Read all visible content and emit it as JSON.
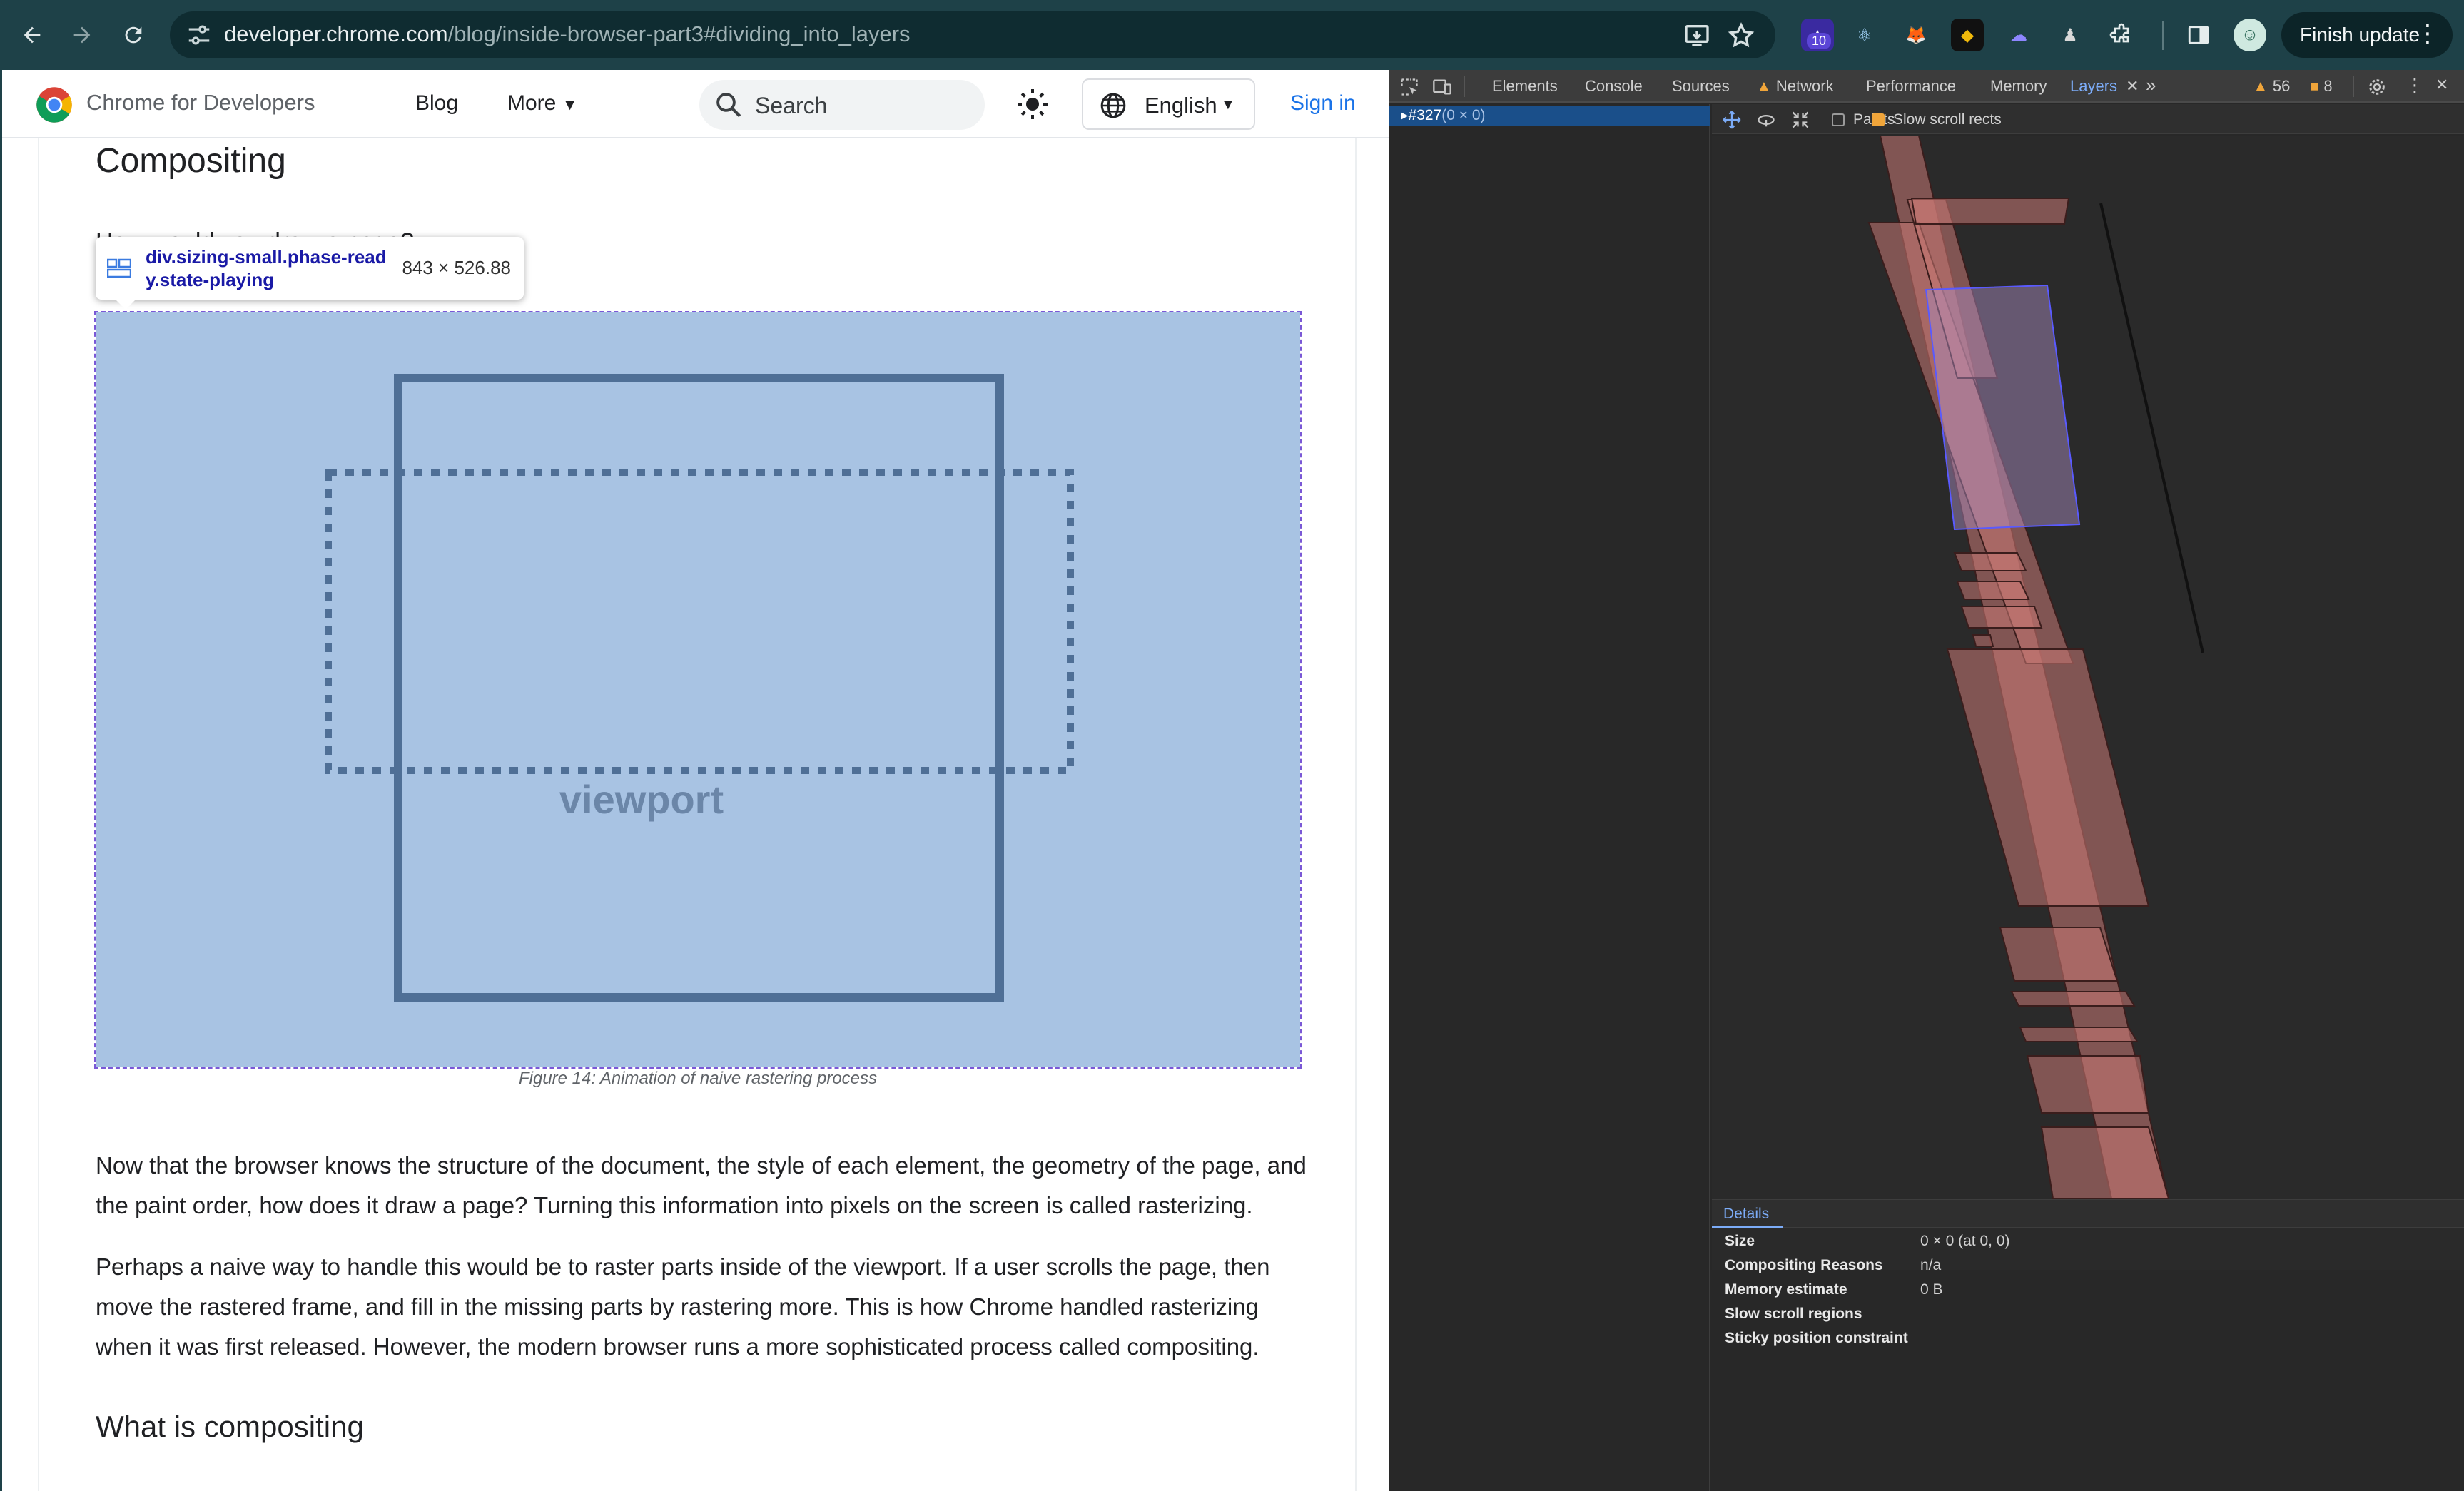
{
  "browser": {
    "url_host": "developer.chrome.com",
    "url_path": "/blog/inside-browser-part3#dividing_into_layers",
    "extension_badge": "10",
    "finish_update_label": "Finish update"
  },
  "site": {
    "brand": "Chrome for Developers",
    "nav": {
      "blog": "Blog",
      "more": "More"
    },
    "search_placeholder": "Search",
    "language": "English",
    "sign_in": "Sign in"
  },
  "article": {
    "heading_compositing": "Compositing",
    "partial_line": "How would you draw a page?",
    "tooltip_selector_line1": "div.sizing-small.phase-read",
    "tooltip_selector_line2": "y.state-playing",
    "tooltip_dims": "843 × 526.88",
    "figure_label": "viewport",
    "figure_caption": "Figure 14: Animation of naive rastering process",
    "paragraph1": "Now that the browser knows the structure of the document, the style of each element, the geometry of the page, and the paint order, how does it draw a page? Turning this information into pixels on the screen is called rasterizing.",
    "paragraph2": "Perhaps a naive way to handle this would be to raster parts inside of the viewport. If a user scrolls the page, then move the rastered frame, and fill in the missing parts by rastering more. This is how Chrome handled rasterizing when it was first released. However, the modern browser runs a more sophisticated process called compositing.",
    "heading_what": "What is compositing"
  },
  "devtools": {
    "tabs": [
      "Elements",
      "Console",
      "Sources",
      "Network",
      "Performance",
      "Memory",
      "Layers"
    ],
    "active_tab": "Layers",
    "warnings": "56",
    "issues": "8",
    "layer_tree_item": "#327",
    "layer_tree_item_dims": "(0 × 0)",
    "toolbar": {
      "paints_label": "Paints",
      "paints_checked": false,
      "slow_scroll_label": "Slow scroll rects",
      "slow_scroll_checked": true
    },
    "details_tab": "Details",
    "details": [
      {
        "key": "Size",
        "value": "0 × 0 (at 0, 0)"
      },
      {
        "key": "Compositing Reasons",
        "value": "n/a"
      },
      {
        "key": "Memory estimate",
        "value": "0 B"
      },
      {
        "key": "Slow scroll regions",
        "value": ""
      },
      {
        "key": "Sticky position constraint",
        "value": ""
      }
    ]
  },
  "colors": {
    "toolbar_bg": "#1e4148",
    "figure_bg": "#a8c3e3",
    "figure_stroke": "#4f6f96",
    "link_blue": "#1a73e8",
    "layer_fill": "#c87874"
  }
}
